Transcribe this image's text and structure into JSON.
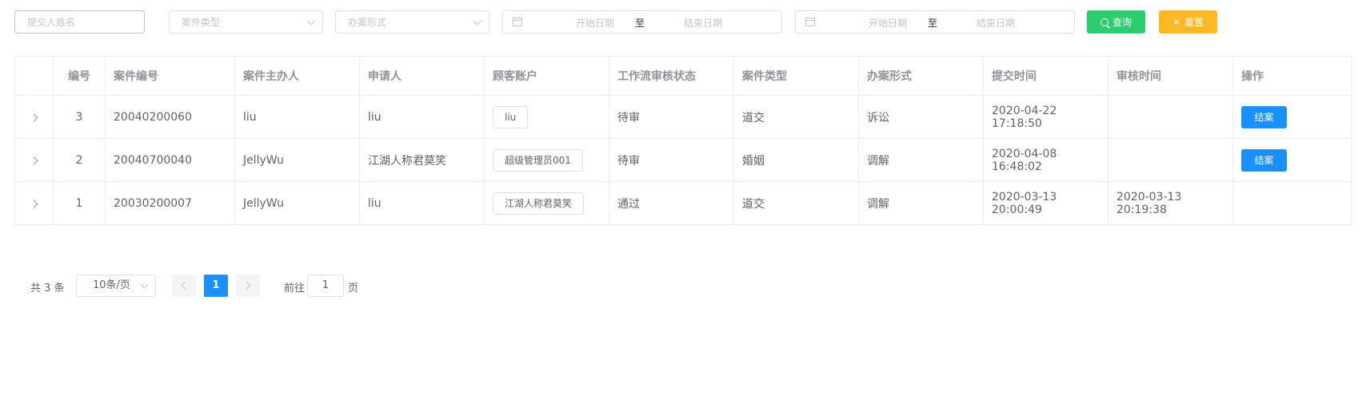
{
  "filters": {
    "submitter_placeholder": "提交人姓名",
    "case_type_placeholder": "案件类型",
    "handling_form_placeholder": "办案形式",
    "date_range_1": {
      "start": "开始日期",
      "separator": "至",
      "end": "结束日期"
    },
    "date_range_2": {
      "start": "开始日期",
      "separator": "至",
      "end": "结束日期"
    },
    "search_label": "查询",
    "reset_label": "重置",
    "reset_glyph": "✕"
  },
  "table": {
    "columns": [
      "",
      "编号",
      "案件编号",
      "案件主办人",
      "申请人",
      "顾客账户",
      "工作流审核状态",
      "案件类型",
      "办案形式",
      "提交时间",
      "审核时间",
      "操作"
    ],
    "rows": [
      {
        "id": "3",
        "case_no": "20040200060",
        "host": "liu",
        "applicant": "liu",
        "account": "liu",
        "status": "待审",
        "case_type": "道交",
        "form": "诉讼",
        "submit_time": "2020-04-22 17:18:50",
        "review_time": "",
        "action": "结案"
      },
      {
        "id": "2",
        "case_no": "20040700040",
        "host": "JellyWu",
        "applicant": "江湖人称君莫笑",
        "account": "超级管理员001",
        "status": "待审",
        "case_type": "婚姻",
        "form": "调解",
        "submit_time": "2020-04-08 16:48:02",
        "review_time": "",
        "action": "结案"
      },
      {
        "id": "1",
        "case_no": "20030200007",
        "host": "JellyWu",
        "applicant": "liu",
        "account": "江湖人称君莫笑",
        "status": "通过",
        "case_type": "道交",
        "form": "调解",
        "submit_time": "2020-03-13 20:00:49",
        "review_time": "2020-03-13 20:19:38",
        "action": ""
      }
    ]
  },
  "pagination": {
    "total_label": "共 3 条",
    "page_size": "10条/页",
    "current_page": "1",
    "goto_label": "前往",
    "goto_value": "1",
    "page_suffix": "页"
  },
  "colors": {
    "search_button": "#2ecc71",
    "reset_button": "#ffb822",
    "primary": "#1890ff"
  }
}
